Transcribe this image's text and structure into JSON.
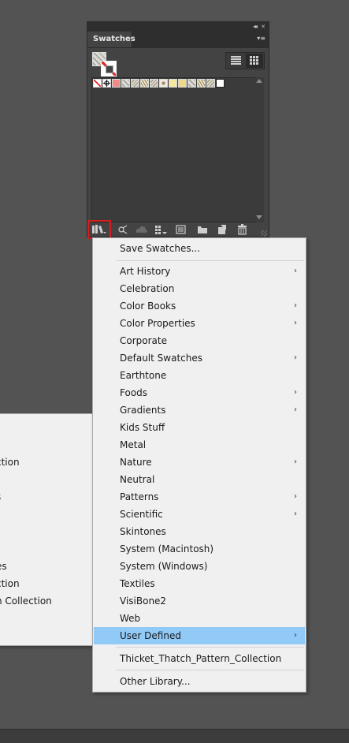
{
  "panel": {
    "title": "Swatches",
    "collapse_glyph": "◂◂",
    "close_glyph": "✕",
    "menu_glyph": "▾≡",
    "swatches": [
      {
        "kind": "none"
      },
      {
        "kind": "registration"
      },
      {
        "color": "#f08a84"
      },
      {
        "kind": "pattern"
      },
      {
        "kind": "pattern"
      },
      {
        "kind": "pattern"
      },
      {
        "kind": "pattern"
      },
      {
        "color": "#f4ecd4"
      },
      {
        "color": "#f6e6a0"
      },
      {
        "color": "#f0d88a"
      },
      {
        "kind": "pattern"
      },
      {
        "kind": "pattern"
      },
      {
        "kind": "pattern"
      },
      {
        "kind": "pattern"
      }
    ],
    "toolbar_icons": [
      "libraries-menu-icon",
      "show-kinds-icon",
      "cloud-libraries-icon",
      "swatch-options-icon",
      "color-group-icon",
      "new-group-icon",
      "new-swatch-icon",
      "delete-swatch-icon"
    ]
  },
  "menu": {
    "save": "Save Swatches...",
    "items": [
      {
        "label": "Art History",
        "sub": true
      },
      {
        "label": "Celebration",
        "sub": false
      },
      {
        "label": "Color Books",
        "sub": true
      },
      {
        "label": "Color Properties",
        "sub": true
      },
      {
        "label": "Corporate",
        "sub": false
      },
      {
        "label": "Default Swatches",
        "sub": true
      },
      {
        "label": "Earthtone",
        "sub": false
      },
      {
        "label": "Foods",
        "sub": true
      },
      {
        "label": "Gradients",
        "sub": true
      },
      {
        "label": "Kids Stuff",
        "sub": false
      },
      {
        "label": "Metal",
        "sub": false
      },
      {
        "label": "Nature",
        "sub": true
      },
      {
        "label": "Neutral",
        "sub": false
      },
      {
        "label": "Patterns",
        "sub": true
      },
      {
        "label": "Scientific",
        "sub": true
      },
      {
        "label": "Skintones",
        "sub": false
      },
      {
        "label": "System (Macintosh)",
        "sub": false
      },
      {
        "label": "System (Windows)",
        "sub": false
      },
      {
        "label": "Textiles",
        "sub": false
      },
      {
        "label": "VisiBone2",
        "sub": false
      },
      {
        "label": "Web",
        "sub": false
      },
      {
        "label": "User Defined",
        "sub": true,
        "highlighted": true
      }
    ],
    "recent": "Thicket_Thatch_Pattern_Collection",
    "other": "Other Library...",
    "arrow": "›"
  },
  "submenu_left": {
    "items": [
      "ction",
      "",
      "s",
      "",
      "",
      "",
      "es",
      "ction",
      "n Collection"
    ]
  },
  "colors": {
    "highlight": "#91c9f7",
    "focus_border": "#d31f1f",
    "background": "#535353"
  }
}
